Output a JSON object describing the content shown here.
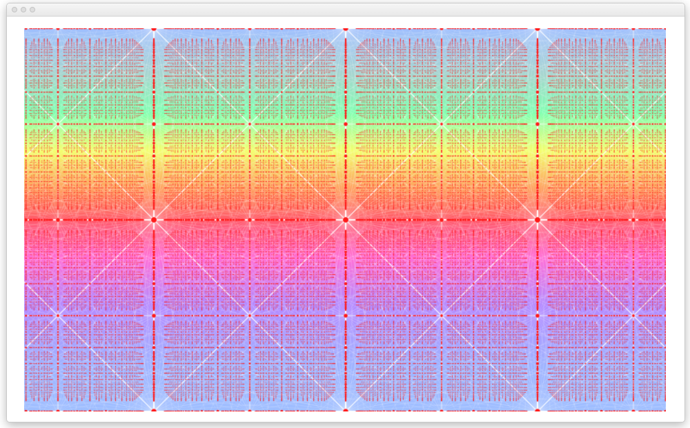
{
  "window": {
    "title": "",
    "buttons": [
      "close",
      "minimize",
      "zoom"
    ]
  },
  "artwork": {
    "description_kind": "periodic lattice pattern",
    "colors": {
      "top": "#9fbfff",
      "upper_mid": "#7fffb0",
      "yellow": "#f4ff70",
      "orange": "#ffa060",
      "center": "#ff5a6a",
      "magenta": "#ff70d8",
      "violet": "#b58aff",
      "bottom": "#9fbfff",
      "dots": "#ff1a1a",
      "rays": "#ffffff"
    },
    "major_columns": 4,
    "major_rows": 2
  }
}
